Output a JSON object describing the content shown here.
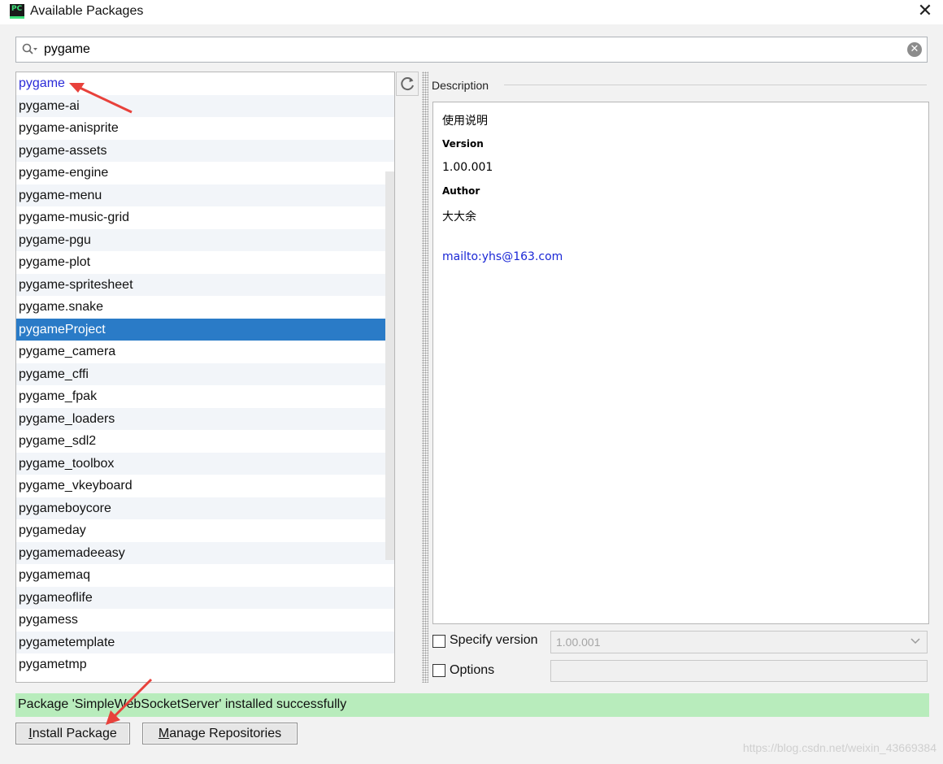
{
  "window": {
    "title": "Available Packages",
    "app_icon_text": "PC",
    "close_glyph": "✕"
  },
  "search": {
    "value": "pygame",
    "clear_glyph": "✕"
  },
  "packages": [
    {
      "name": "pygame",
      "state": "link"
    },
    {
      "name": "pygame-ai"
    },
    {
      "name": "pygame-anisprite"
    },
    {
      "name": "pygame-assets"
    },
    {
      "name": "pygame-engine"
    },
    {
      "name": "pygame-menu"
    },
    {
      "name": "pygame-music-grid"
    },
    {
      "name": "pygame-pgu"
    },
    {
      "name": "pygame-plot"
    },
    {
      "name": "pygame-spritesheet"
    },
    {
      "name": "pygame.snake"
    },
    {
      "name": "pygameProject",
      "state": "selected"
    },
    {
      "name": "pygame_camera"
    },
    {
      "name": "pygame_cffi"
    },
    {
      "name": "pygame_fpak"
    },
    {
      "name": "pygame_loaders"
    },
    {
      "name": "pygame_sdl2"
    },
    {
      "name": "pygame_toolbox"
    },
    {
      "name": "pygame_vkeyboard"
    },
    {
      "name": "pygameboycore"
    },
    {
      "name": "pygameday"
    },
    {
      "name": "pygamemadeeasy"
    },
    {
      "name": "pygamemaq"
    },
    {
      "name": "pygameoflife"
    },
    {
      "name": "pygamess"
    },
    {
      "name": "pygametemplate"
    },
    {
      "name": "pygametmp"
    }
  ],
  "description": {
    "label": "Description",
    "heading": "使用说明",
    "version_label": "Version",
    "version_value": "1.00.001",
    "author_label": "Author",
    "author_value": "大大余",
    "email_link": "mailto:yhs@163.com"
  },
  "options": {
    "specify_version_label": "Specify version",
    "specify_version_checked": false,
    "version_select_value": "1.00.001",
    "options_label": "Options",
    "options_checked": false,
    "options_value": ""
  },
  "status": {
    "message": "Package 'SimpleWebSocketServer' installed successfully",
    "color": "#b8ecbc"
  },
  "buttons": {
    "install": "Install Package",
    "manage": "Manage Repositories"
  },
  "watermark": "https://blog.csdn.net/weixin_43669384",
  "colors": {
    "selection": "#2a7bc7",
    "link": "#2b2bd8",
    "annotation_arrow": "#e8413b"
  },
  "icons": {
    "search": "search-icon",
    "refresh": "refresh-icon",
    "clear": "clear-icon",
    "close": "close-icon",
    "chevron": "chevron-down-icon"
  }
}
